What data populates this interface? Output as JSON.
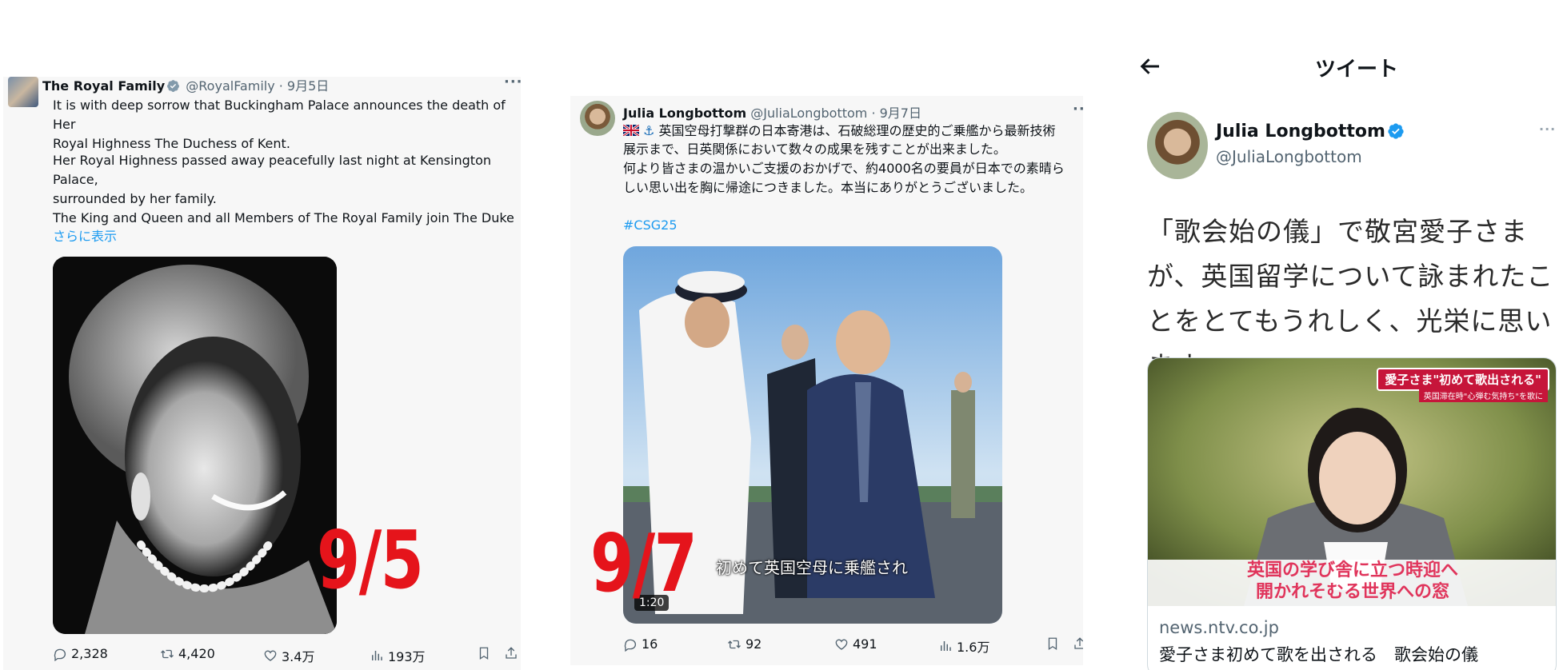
{
  "tweet1": {
    "name": "The Royal Family",
    "handle": "@RoyalFamily · 9月5日",
    "text_p1": "It is with deep sorrow that Buckingham Palace announces the death of Her\nRoyal Highness The Duchess of Kent.",
    "text_p2": "Her Royal Highness passed away peacefully last night at Kensington Palace,\nsurrounded by her family.",
    "text_p3": "The King and Queen and all Members of The Royal Family join The Duke",
    "show_more": "さらに表示",
    "date_mark": "9/5",
    "replies": "2,328",
    "retweets": "4,420",
    "likes": "3.4万",
    "views": "193万"
  },
  "tweet2": {
    "name": "Julia Longbottom",
    "handle": "@JuliaLongbottom · 9月7日",
    "text_line1": "英国空母打撃群の日本寄港は、石破総理の歴史的ご乗艦から最新技術",
    "text_rest": "展示まで、日英関係において数々の成果を残すことが出来ました。\n何より皆さまの温かいご支援のおかげで、約4000名の要員が日本での素晴ら\nしい思い出を胸に帰途につきました。本当にありがとうございました。",
    "hashtag": "#CSG25",
    "video_caption": "初めて英国空母に乗艦され",
    "video_duration": "1:20",
    "date_mark": "9/7",
    "replies": "16",
    "retweets": "92",
    "likes": "491",
    "views": "1.6万"
  },
  "tweet3": {
    "header_title": "ツイート",
    "name": "Julia Longbottom",
    "handle": "@JuliaLongbottom",
    "text": "「歌会始の儀」で敬宮愛子さまが、英国留学について詠まれたことをとてもうれしく、光栄に思います。",
    "card_tag": "愛子さま\"初めて歌出される\"",
    "card_subtag": "英国滞在時\"心弾む気持ち\"を歌に",
    "card_banner_line1": "英国の学び舎に立つ時迎へ",
    "card_banner_line2": "開かれそむる世界への窓",
    "card_domain": "news.ntv.co.jp",
    "card_title": "愛子さま初めて歌を出される　歌会始の儀"
  },
  "colors": {
    "link": "#1d9bf0",
    "verified": "#1d9bf0",
    "date_mark": "#e5141b",
    "text": "#0f1419",
    "muted": "#536471"
  }
}
